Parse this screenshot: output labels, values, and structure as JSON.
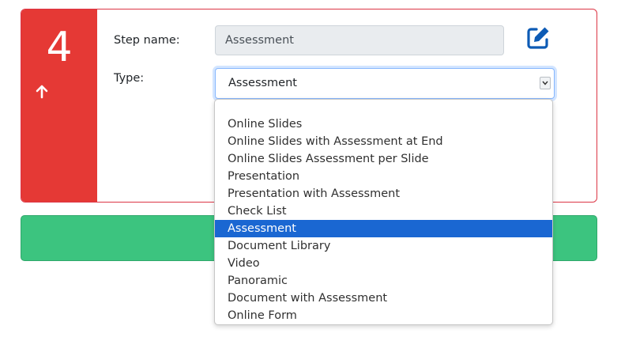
{
  "step": {
    "number": "4",
    "name_label": "Step name:",
    "name_value": "Assessment",
    "type_label": "Type:",
    "type_value": "Assessment"
  },
  "colors": {
    "rail": "#e53935",
    "card_border": "#dc3545",
    "add_bar": "#3cc47f",
    "selected_option": "#1a67d2",
    "edit_icon": "#0d5bb5"
  },
  "icons": {
    "move_up": "arrow-up-icon",
    "edit": "edit-square-pen-icon",
    "caret": "chevron-down-icon"
  },
  "type_options": [
    {
      "label": "Online Slides",
      "selected": false
    },
    {
      "label": "Online Slides with Assessment at End",
      "selected": false
    },
    {
      "label": "Online Slides Assessment per Slide",
      "selected": false
    },
    {
      "label": "Presentation",
      "selected": false
    },
    {
      "label": "Presentation with Assessment",
      "selected": false
    },
    {
      "label": "Check List",
      "selected": false
    },
    {
      "label": "Assessment",
      "selected": true
    },
    {
      "label": "Document Library",
      "selected": false
    },
    {
      "label": "Video",
      "selected": false
    },
    {
      "label": "Panoramic",
      "selected": false
    },
    {
      "label": "Document with Assessment",
      "selected": false
    },
    {
      "label": "Online Form",
      "selected": false
    }
  ]
}
